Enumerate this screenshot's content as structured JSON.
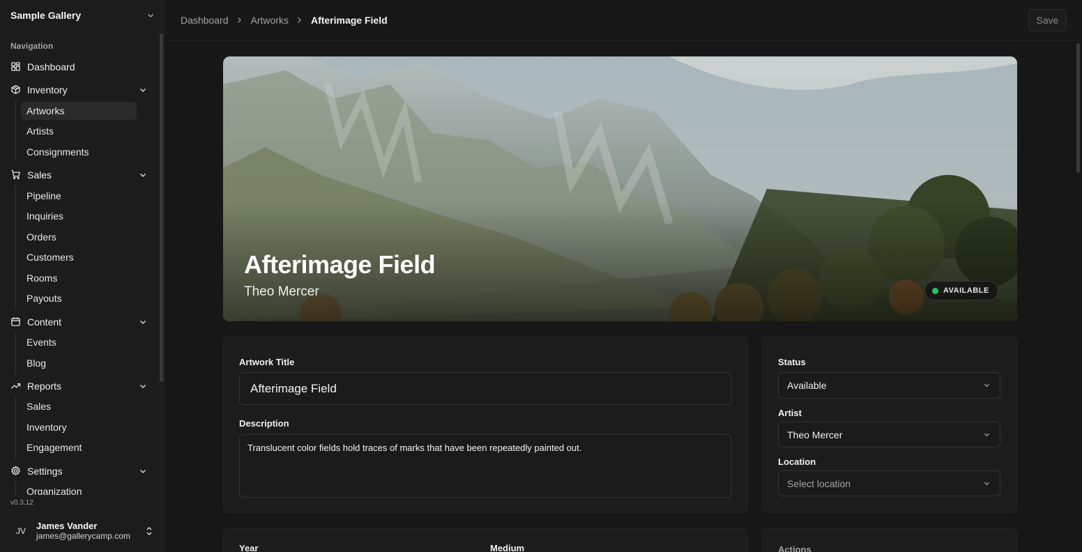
{
  "sidebar": {
    "org_name": "Sample Gallery",
    "section_label": "Navigation",
    "dashboard": "Dashboard",
    "groups": [
      {
        "label": "Inventory",
        "icon": "package-icon",
        "items": [
          "Artworks",
          "Artists",
          "Consignments"
        ]
      },
      {
        "label": "Sales",
        "icon": "cart-icon",
        "items": [
          "Pipeline",
          "Inquiries",
          "Orders",
          "Customers",
          "Rooms",
          "Payouts"
        ]
      },
      {
        "label": "Content",
        "icon": "calendar-icon",
        "items": [
          "Events",
          "Blog"
        ]
      },
      {
        "label": "Reports",
        "icon": "trending-up-icon",
        "items": [
          "Sales",
          "Inventory",
          "Engagement"
        ]
      },
      {
        "label": "Settings",
        "icon": "gear-icon",
        "items": [
          "Organization"
        ]
      }
    ],
    "active_item": "Artworks",
    "version": "v0.3.12",
    "user": {
      "initials": "JV",
      "name": "James Vander",
      "email": "james@gallerycamp.com"
    }
  },
  "breadcrumb": [
    "Dashboard",
    "Artworks",
    "Afterimage Field"
  ],
  "toolbar": {
    "save_label": "Save"
  },
  "hero": {
    "title": "Afterimage Field",
    "artist": "Theo Mercer",
    "status_badge": "AVAILABLE"
  },
  "form": {
    "title_label": "Artwork Title",
    "title_value": "Afterimage Field",
    "description_label": "Description",
    "description_value": "Translucent color fields hold traces of marks that have been repeatedly painted out.",
    "year_label": "Year",
    "medium_label": "Medium"
  },
  "side_panel": {
    "status_label": "Status",
    "status_value": "Available",
    "artist_label": "Artist",
    "artist_value": "Theo Mercer",
    "location_label": "Location",
    "location_placeholder": "Select location",
    "actions_label": "Actions"
  },
  "colors": {
    "accent_status": "#22c55e",
    "background": "#171717"
  }
}
